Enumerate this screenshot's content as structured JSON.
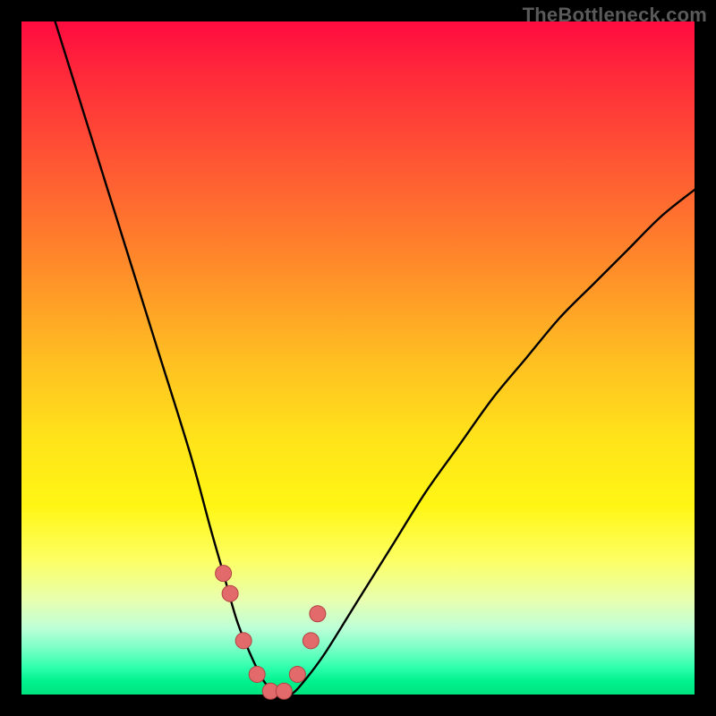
{
  "watermark": "TheBottleneck.com",
  "chart_data": {
    "type": "line",
    "title": "",
    "xlabel": "",
    "ylabel": "",
    "xlim": [
      0,
      100
    ],
    "ylim": [
      0,
      100
    ],
    "series": [
      {
        "name": "bottleneck-curve",
        "x": [
          5,
          10,
          15,
          20,
          25,
          28,
          30,
          32,
          34,
          36,
          38,
          40,
          42,
          45,
          50,
          55,
          60,
          65,
          70,
          75,
          80,
          85,
          90,
          95,
          100
        ],
        "y": [
          100,
          84,
          68,
          52,
          36,
          25,
          18,
          11,
          6,
          2,
          0,
          0,
          2,
          6,
          14,
          22,
          30,
          37,
          44,
          50,
          56,
          61,
          66,
          71,
          75
        ]
      }
    ],
    "markers": {
      "name": "highlighted-points",
      "x": [
        30,
        31,
        33,
        35,
        37,
        39,
        41,
        43,
        44
      ],
      "y": [
        18,
        15,
        8,
        3,
        0.5,
        0.5,
        3,
        8,
        12
      ]
    },
    "gradient_stops": [
      {
        "pos": 0,
        "color": "#ff0b40"
      },
      {
        "pos": 22,
        "color": "#ff5a33"
      },
      {
        "pos": 50,
        "color": "#ffbe22"
      },
      {
        "pos": 72,
        "color": "#fff614"
      },
      {
        "pos": 90,
        "color": "#bfffd6"
      },
      {
        "pos": 100,
        "color": "#00e47f"
      }
    ]
  }
}
